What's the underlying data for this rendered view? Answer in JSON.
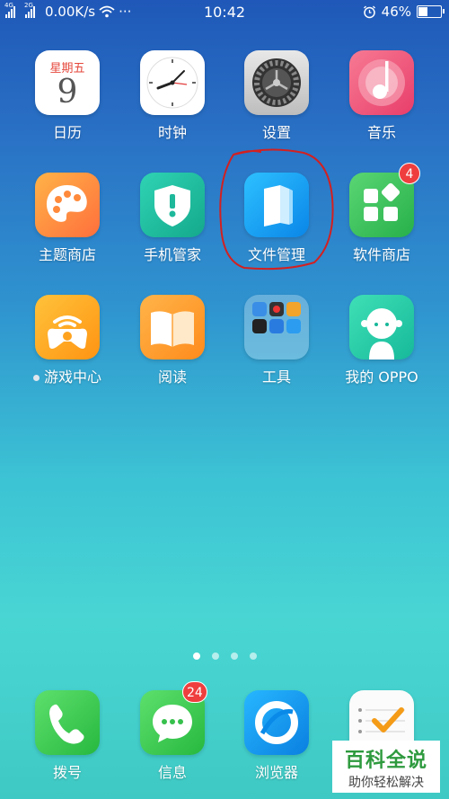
{
  "status_bar": {
    "net1": "4G",
    "net2": "2G",
    "speed": "0.00K/s",
    "more": "···",
    "time": "10:42",
    "battery_text": "46%",
    "battery_level": 0.46
  },
  "apps": [
    {
      "label": "日历",
      "calendar_weekday": "星期五",
      "calendar_day": "9"
    },
    {
      "label": "时钟"
    },
    {
      "label": "设置"
    },
    {
      "label": "音乐"
    },
    {
      "label": "主题商店"
    },
    {
      "label": "手机管家"
    },
    {
      "label": "文件管理"
    },
    {
      "label": "软件商店",
      "badge": "4"
    },
    {
      "label": "游戏中心"
    },
    {
      "label": "阅读"
    },
    {
      "label": "工具"
    },
    {
      "label": "我的 OPPO"
    }
  ],
  "dock": [
    {
      "label": "拨号"
    },
    {
      "label": "信息",
      "badge": "24"
    },
    {
      "label": "浏览器"
    },
    {
      "label": "便签"
    }
  ],
  "page_indicator": {
    "count": 4,
    "active": 0
  },
  "watermark": {
    "title": "百科全说",
    "subtitle": "助你轻松解决"
  },
  "colors": {
    "annotation": "#d32020",
    "badge": "#ef3e3e"
  }
}
